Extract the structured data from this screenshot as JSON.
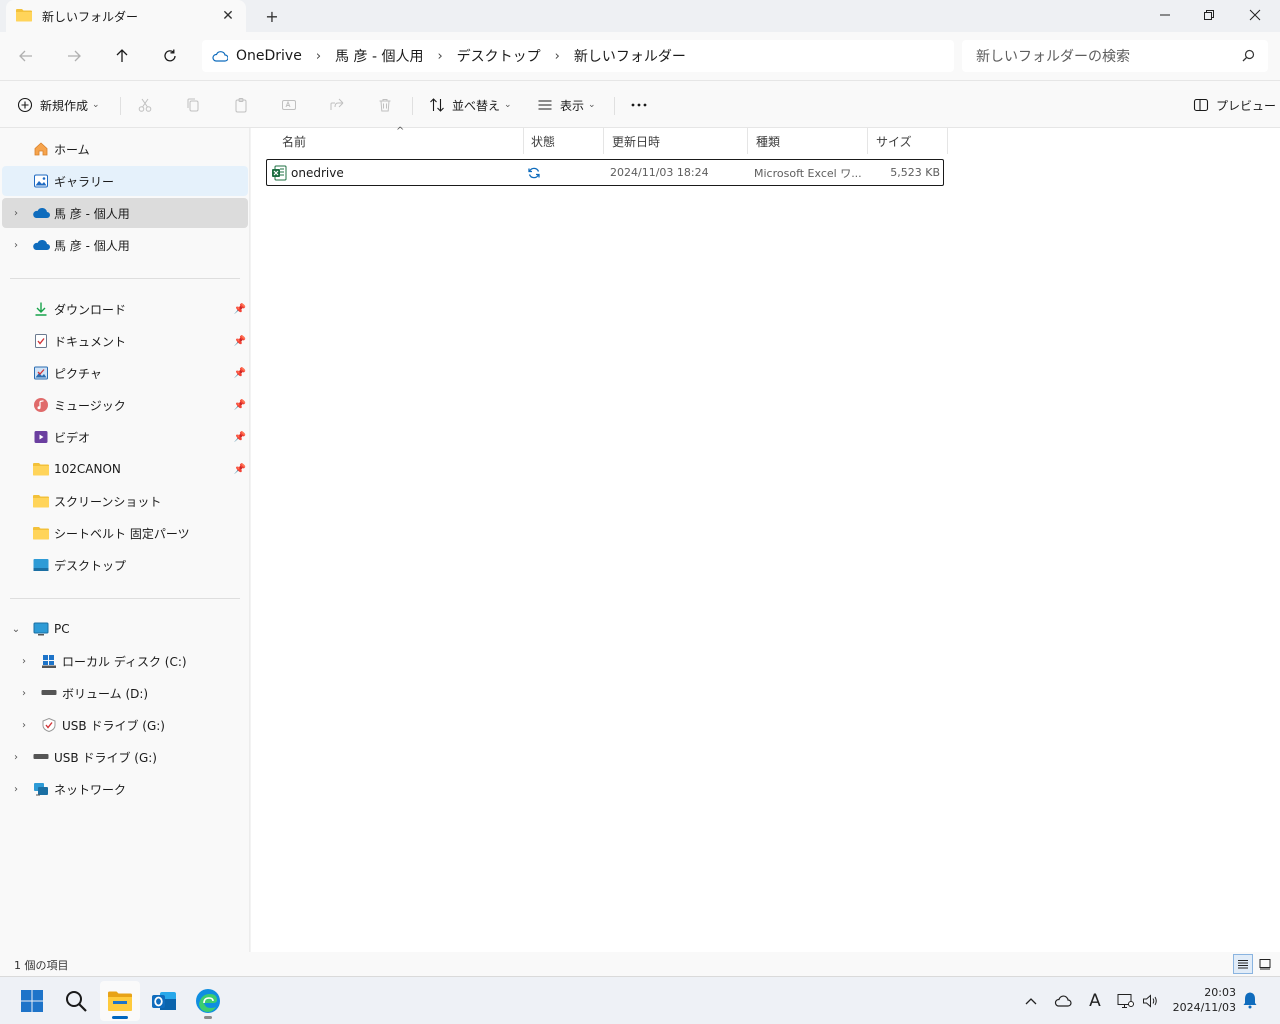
{
  "window": {
    "tab_title": "新しいフォルダー",
    "close_tab": "✕",
    "new_tab": "+"
  },
  "address": {
    "crumbs": [
      "OneDrive",
      "馬 彦 - 個人用",
      "デスクトップ",
      "新しいフォルダー"
    ],
    "separator": "›"
  },
  "search": {
    "placeholder": "新しいフォルダーの検索"
  },
  "commands": {
    "new": "新規作成",
    "sort": "並べ替え",
    "view": "表示",
    "more": "…",
    "preview": "プレビュー"
  },
  "sidebar": {
    "home": "ホーム",
    "gallery": "ギャラリー",
    "onedrive1": "馬 彦 - 個人用",
    "onedrive2": "馬 彦 - 個人用",
    "quick": [
      {
        "label": "ダウンロード",
        "icon": "download-icon"
      },
      {
        "label": "ドキュメント",
        "icon": "documents-icon"
      },
      {
        "label": "ピクチャ",
        "icon": "pictures-icon"
      },
      {
        "label": "ミュージック",
        "icon": "music-icon"
      },
      {
        "label": "ビデオ",
        "icon": "videos-icon"
      },
      {
        "label": "102CANON",
        "icon": "folder-icon"
      },
      {
        "label": "スクリーンショット",
        "icon": "folder-icon"
      },
      {
        "label": "シートベルト 固定パーツ",
        "icon": "folder-icon"
      },
      {
        "label": "デスクトップ",
        "icon": "desktop-icon"
      }
    ],
    "pc": "PC",
    "drive_c": "ローカル ディスク (C:)",
    "drive_d": "ボリューム (D:)",
    "drive_g_child": "USB ドライブ (G:)",
    "drive_g": "USB ドライブ (G:)",
    "network": "ネットワーク"
  },
  "columns": {
    "name": "名前",
    "status": "状態",
    "modified": "更新日時",
    "type": "種類",
    "size": "サイズ"
  },
  "files": [
    {
      "name": "onedrive",
      "modified": "2024/11/03 18:24",
      "type": "Microsoft Excel ワ...",
      "size": "5,523 KB"
    }
  ],
  "status": {
    "count": "1 個の項目"
  },
  "taskbar": {
    "time": "20:03",
    "date": "2024/11/03",
    "ime": "A"
  },
  "colors": {
    "accent": "#0067c0",
    "folder": "#f3c13a",
    "onedrive": "#0f6cbd",
    "excel": "#1d6f42"
  }
}
